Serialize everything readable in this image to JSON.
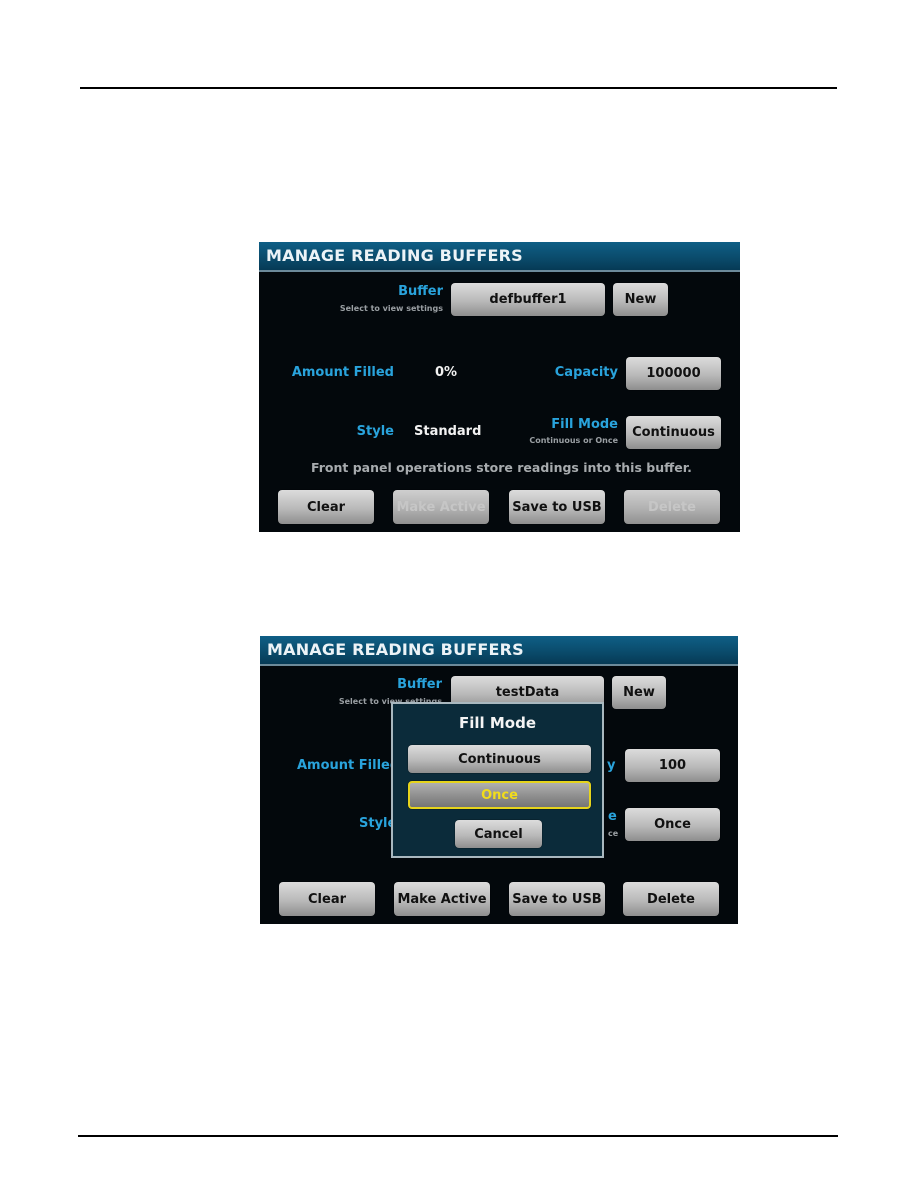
{
  "page": {
    "rules": [
      "top-rule",
      "bottom-rule"
    ]
  },
  "screen1": {
    "header_title": "MANAGE READING BUFFERS",
    "buffer_label": "Buffer",
    "buffer_sublabel": "Select to view settings",
    "buffer_value": "defbuffer1",
    "new_label": "New",
    "amount_filled_label": "Amount Filled",
    "amount_filled_value": "0%",
    "capacity_label": "Capacity",
    "capacity_value": "100000",
    "style_label": "Style",
    "style_value": "Standard",
    "fill_mode_label": "Fill Mode",
    "fill_mode_sublabel": "Continuous or Once",
    "fill_mode_value": "Continuous",
    "note": "Front panel operations store readings into this buffer.",
    "buttons": [
      {
        "label": "Clear",
        "enabled": true
      },
      {
        "label": "Make Active",
        "enabled": false
      },
      {
        "label": "Save to USB",
        "enabled": true
      },
      {
        "label": "Delete",
        "enabled": false
      }
    ]
  },
  "screen2": {
    "header_title": "MANAGE READING BUFFERS",
    "buffer_label": "Buffer",
    "buffer_sublabel": "Select to view settings",
    "buffer_value": "testData",
    "new_label": "New",
    "amount_filled_label": "Amount Filled",
    "capacity_label_partial": "y",
    "capacity_value": "100",
    "style_label": "Style",
    "fill_mode_label_partial": "e",
    "fill_mode_sublabel_partial": "ce",
    "fill_mode_value": "Once",
    "buttons": [
      {
        "label": "Clear",
        "enabled": true
      },
      {
        "label": "Make Active",
        "enabled": true
      },
      {
        "label": "Save to USB",
        "enabled": true
      },
      {
        "label": "Delete",
        "enabled": true
      }
    ],
    "dialog": {
      "title": "Fill Mode",
      "options": [
        {
          "label": "Continuous",
          "selected": false
        },
        {
          "label": "Once",
          "selected": true
        }
      ],
      "cancel_label": "Cancel"
    }
  },
  "colors": {
    "label_blue": "#29a3dc",
    "header_blue": "#0a4a6a",
    "selected_yellow": "#e6d41c",
    "screen_bg": "#03080c",
    "dialog_bg": "#0b2b3a"
  }
}
